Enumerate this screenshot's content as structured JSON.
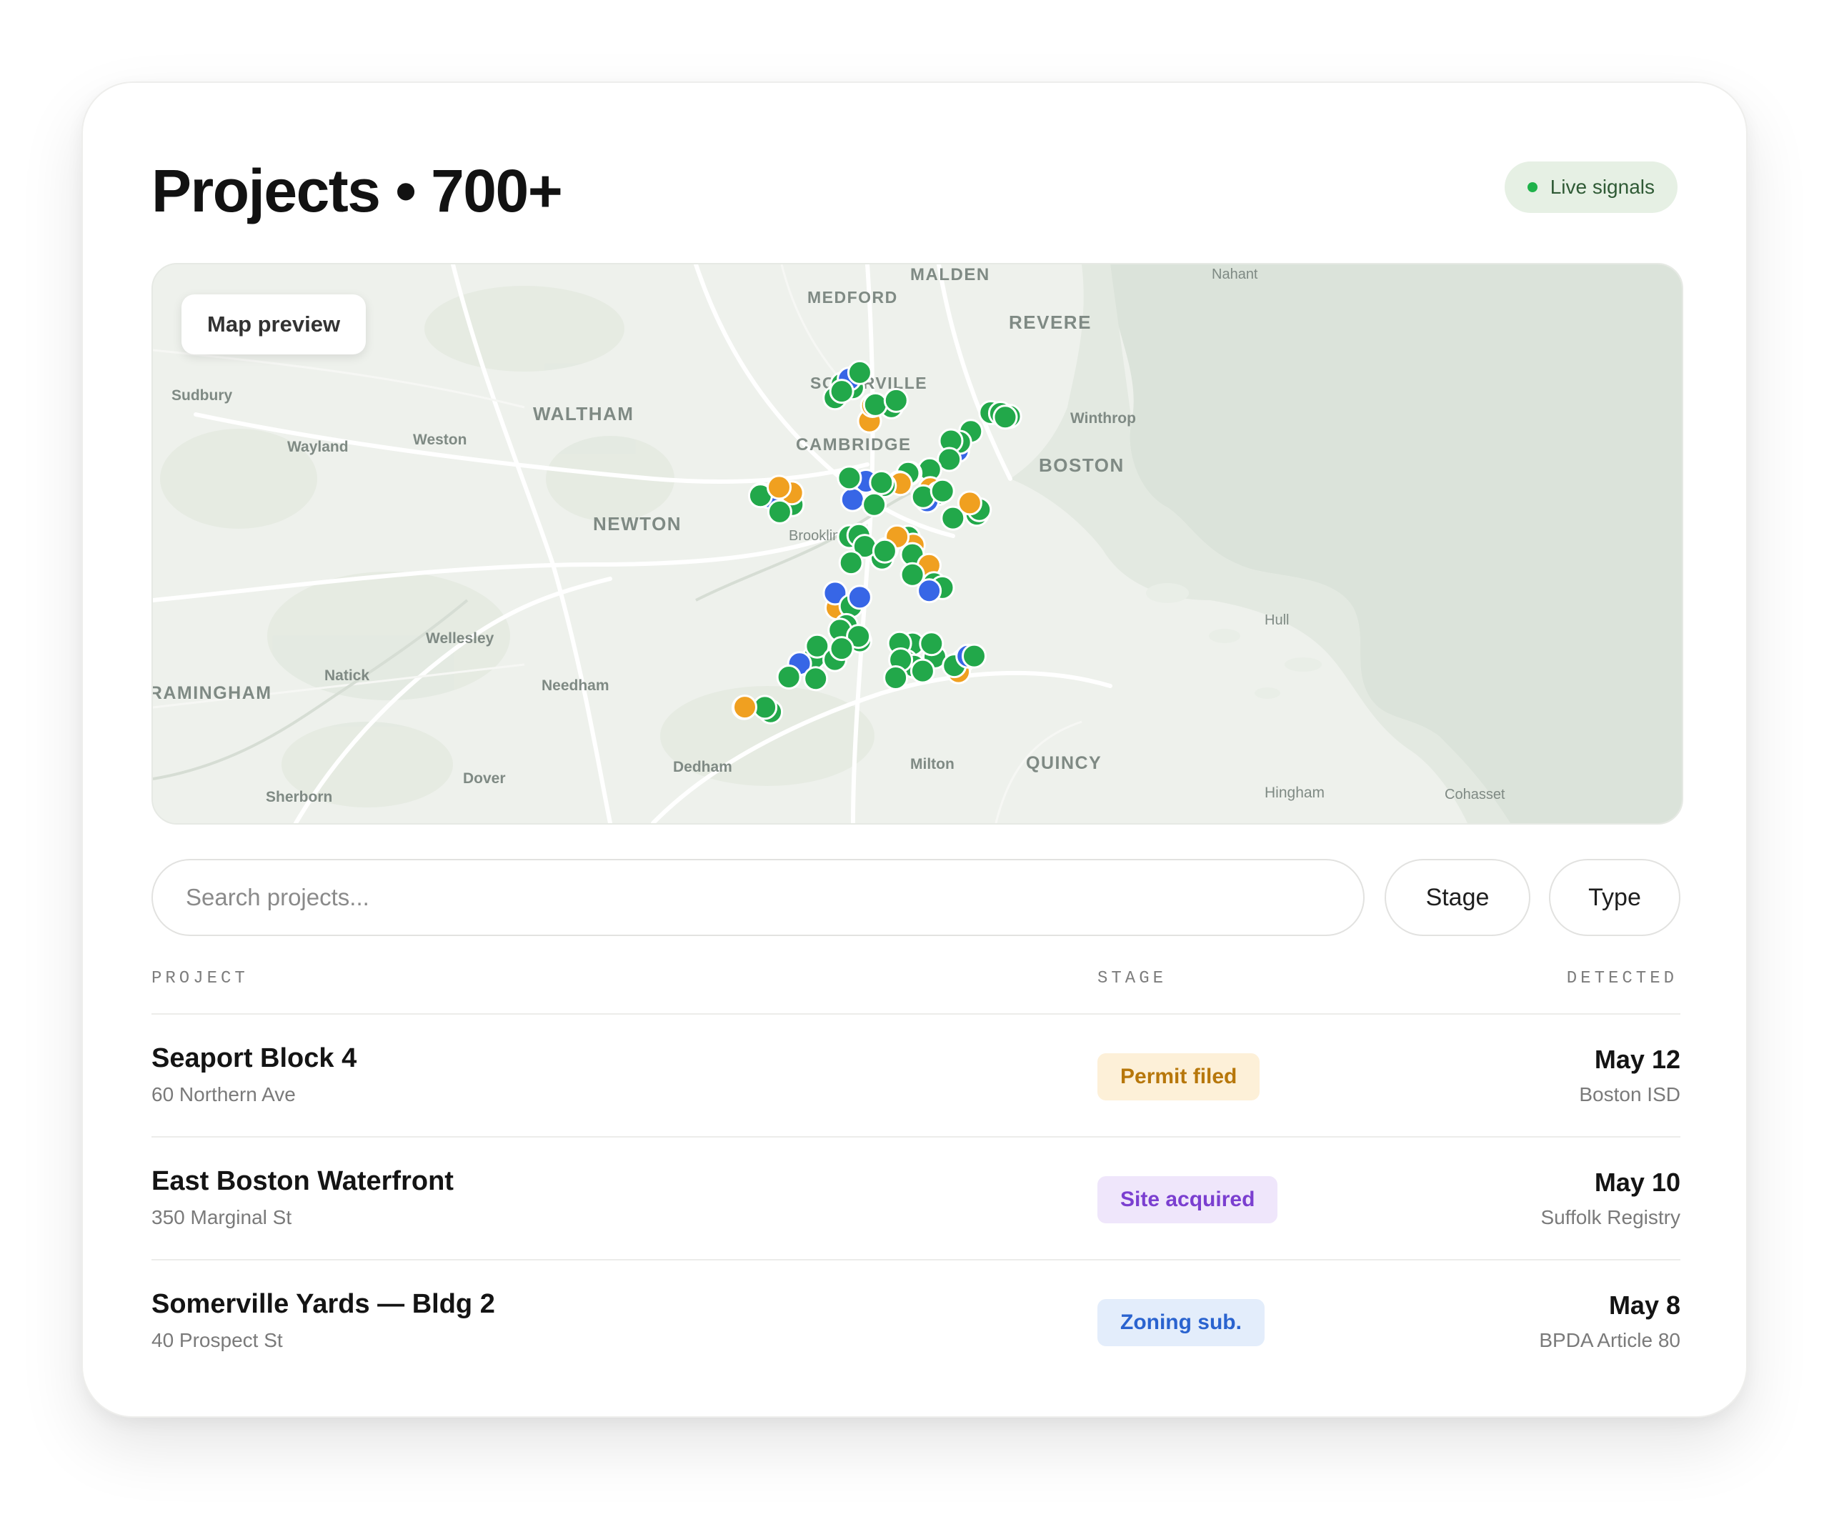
{
  "header": {
    "title": "Projects • 700+",
    "live_badge": "Live signals"
  },
  "colors": {
    "accent_green": "#1fb24a",
    "marker_green": "#22a84a",
    "marker_blue": "#3766e6",
    "marker_orange": "#f0a020"
  },
  "map": {
    "chip_label": "Map preview",
    "place_labels": [
      {
        "text": "MALDEN",
        "style": "major"
      },
      {
        "text": "MEDFORD",
        "style": "major"
      },
      {
        "text": "Nahant",
        "style": "minor"
      },
      {
        "text": "REVERE",
        "style": "major"
      },
      {
        "text": "SOMERVILLE",
        "style": "major"
      },
      {
        "text": "Sudbury",
        "style": "minor"
      },
      {
        "text": "WALTHAM",
        "style": "major"
      },
      {
        "text": "Winthrop",
        "style": "minor"
      },
      {
        "text": "Wayland",
        "style": "minor"
      },
      {
        "text": "Weston",
        "style": "minor"
      },
      {
        "text": "CAMBRIDGE",
        "style": "major"
      },
      {
        "text": "BOSTON",
        "style": "major"
      },
      {
        "text": "NEWTON",
        "style": "major"
      },
      {
        "text": "Brookline",
        "style": "minor"
      },
      {
        "text": "Hull",
        "style": "minor"
      },
      {
        "text": "Wellesley",
        "style": "minor"
      },
      {
        "text": "Natick",
        "style": "minor"
      },
      {
        "text": "FRAMINGHAM",
        "style": "major"
      },
      {
        "text": "Needham",
        "style": "minor"
      },
      {
        "text": "Dedham",
        "style": "minor"
      },
      {
        "text": "Milton",
        "style": "minor"
      },
      {
        "text": "QUINCY",
        "style": "major"
      },
      {
        "text": "Dover",
        "style": "minor"
      },
      {
        "text": "Hingham",
        "style": "minor"
      },
      {
        "text": "Cohasset",
        "style": "minor"
      },
      {
        "text": "Sherborn",
        "style": "minor"
      }
    ]
  },
  "search": {
    "placeholder": "Search projects...",
    "value": ""
  },
  "filters": {
    "stage_label": "Stage",
    "type_label": "Type"
  },
  "table": {
    "headers": {
      "project": "PROJECT",
      "stage": "STAGE",
      "detected": "DETECTED"
    },
    "rows": [
      {
        "name": "Seaport Block 4",
        "address": "60 Northern Ave",
        "stage": "Permit filed",
        "stage_bg": "#fdf0d8",
        "stage_fg": "#b7770b",
        "date": "May 12",
        "source": "Boston ISD"
      },
      {
        "name": "East Boston Waterfront",
        "address": "350 Marginal St",
        "stage": "Site acquired",
        "stage_bg": "#efe6fb",
        "stage_fg": "#7b3fd0",
        "date": "May 10",
        "source": "Suffolk Registry"
      },
      {
        "name": "Somerville Yards — Bldg 2",
        "address": "40 Prospect St",
        "stage": "Zoning sub.",
        "stage_bg": "#e3edfb",
        "stage_fg": "#2a63cf",
        "date": "May 8",
        "source": "BPDA Article 80"
      }
    ]
  }
}
